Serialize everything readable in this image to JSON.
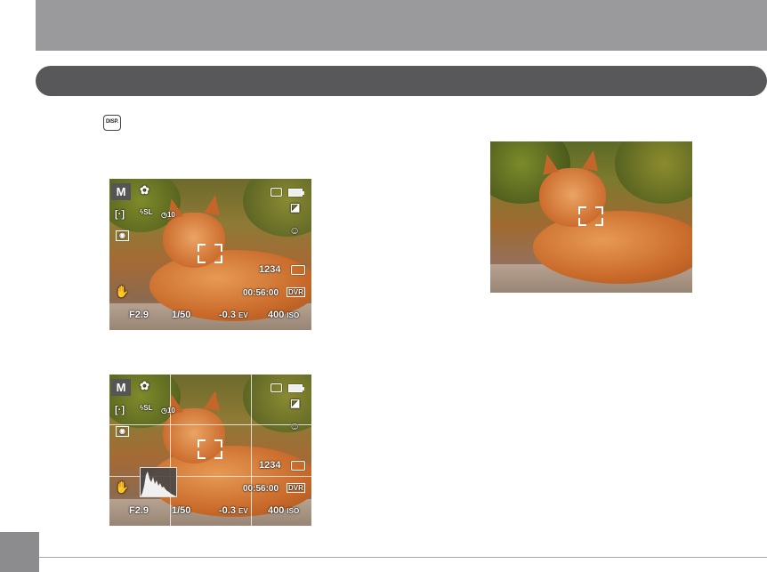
{
  "header": {
    "title": ""
  },
  "section": {
    "title": ""
  },
  "disp_button": {
    "label": "DISP."
  },
  "osd": {
    "mode": "M",
    "flash_mode": "SL",
    "self_timer": "10",
    "shots_remaining": "1234",
    "record_time": "00:56:00",
    "video_format": "DVR",
    "aperture": "F2.9",
    "shutter": "1/50",
    "ev_value": "-0.3",
    "ev_unit": "EV",
    "iso_value": "400",
    "iso_unit": "ISO"
  },
  "colors": {
    "header_band": "#9a9a9c",
    "section_bar": "#58585a",
    "page_tab": "#8c8c8e"
  },
  "icons": [
    "disp-icon",
    "macro-icon",
    "flash-slow-sync-icon",
    "self-timer-icon",
    "af-area-icon",
    "metering-icon",
    "memory-card-icon",
    "battery-icon",
    "white-balance-icon",
    "face-detect-icon",
    "image-size-icon",
    "video-size-icon",
    "stabilizer-icon",
    "histogram-icon"
  ]
}
